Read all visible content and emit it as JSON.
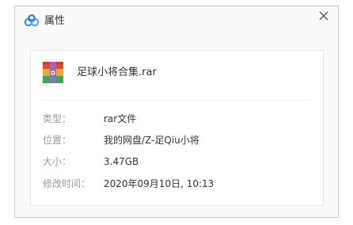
{
  "window": {
    "title": "属性",
    "app_icon": "baidu-netdisk-cloud-icon",
    "close_icon": "close-icon"
  },
  "file": {
    "name": "足球小将合集.rar",
    "icon": "rar-archive-icon"
  },
  "properties": [
    {
      "label": "类型：",
      "value": "rar文件"
    },
    {
      "label": "位置：",
      "value": "我的网盘/Z-足Qiu小将"
    },
    {
      "label": "大小：",
      "value": "3.47GB"
    },
    {
      "label": "修改时间：",
      "value": "2020年09月10日, 10:13"
    }
  ],
  "colors": {
    "accent_blue": "#3a8ee6",
    "label_gray": "#9a9a9a",
    "text_dark": "#333333"
  }
}
